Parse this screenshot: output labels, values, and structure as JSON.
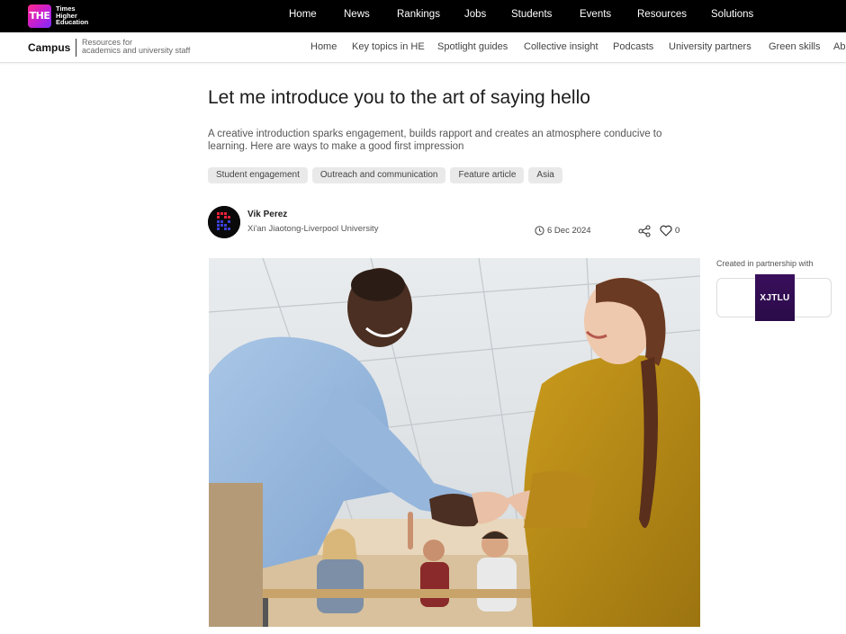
{
  "brand": {
    "badge": "THE",
    "name_lines": [
      "Times",
      "Higher",
      "Education"
    ]
  },
  "main_nav": [
    {
      "label": "Home"
    },
    {
      "label": "News"
    },
    {
      "label": "Rankings"
    },
    {
      "label": "Jobs"
    },
    {
      "label": "Students"
    },
    {
      "label": "Events"
    },
    {
      "label": "Resources"
    },
    {
      "label": "Solutions"
    }
  ],
  "campus": {
    "label": "Campus",
    "tagline_lines": [
      "Resources for",
      "academics and university staff"
    ]
  },
  "sub_nav": [
    {
      "label": "Home"
    },
    {
      "label": "Key topics in HE"
    },
    {
      "label": "Spotlight guides"
    },
    {
      "label": "Collective insight"
    },
    {
      "label": "Podcasts"
    },
    {
      "label": "University partners"
    },
    {
      "label": "Green skills"
    },
    {
      "label": "Ab"
    }
  ],
  "article": {
    "title": "Let me introduce you to the art of saying hello",
    "standfirst": "A creative introduction sparks engagement, builds rapport and creates an atmosphere conducive to learning. Here are ways to make a good first impression",
    "tags": [
      {
        "label": "Student engagement"
      },
      {
        "label": "Outreach and communication"
      },
      {
        "label": "Feature article"
      },
      {
        "label": "Asia"
      }
    ],
    "author": {
      "name": "Vik Perez",
      "institution": "Xi'an Jiaotong-Liverpool University"
    },
    "date": "6 Dec 2024",
    "likes": "0"
  },
  "partner": {
    "label": "Created in partnership with",
    "logo_text": "XJTLU"
  },
  "colors": {
    "topbar": "#000000",
    "badge_gradient_start": "#ff2a8a",
    "badge_gradient_end": "#7b2cff",
    "partner_logo": "#3a0f5c",
    "tag_bg": "#e9e9e9"
  },
  "icons": [
    "clock-icon",
    "share-icon",
    "heart-icon"
  ]
}
